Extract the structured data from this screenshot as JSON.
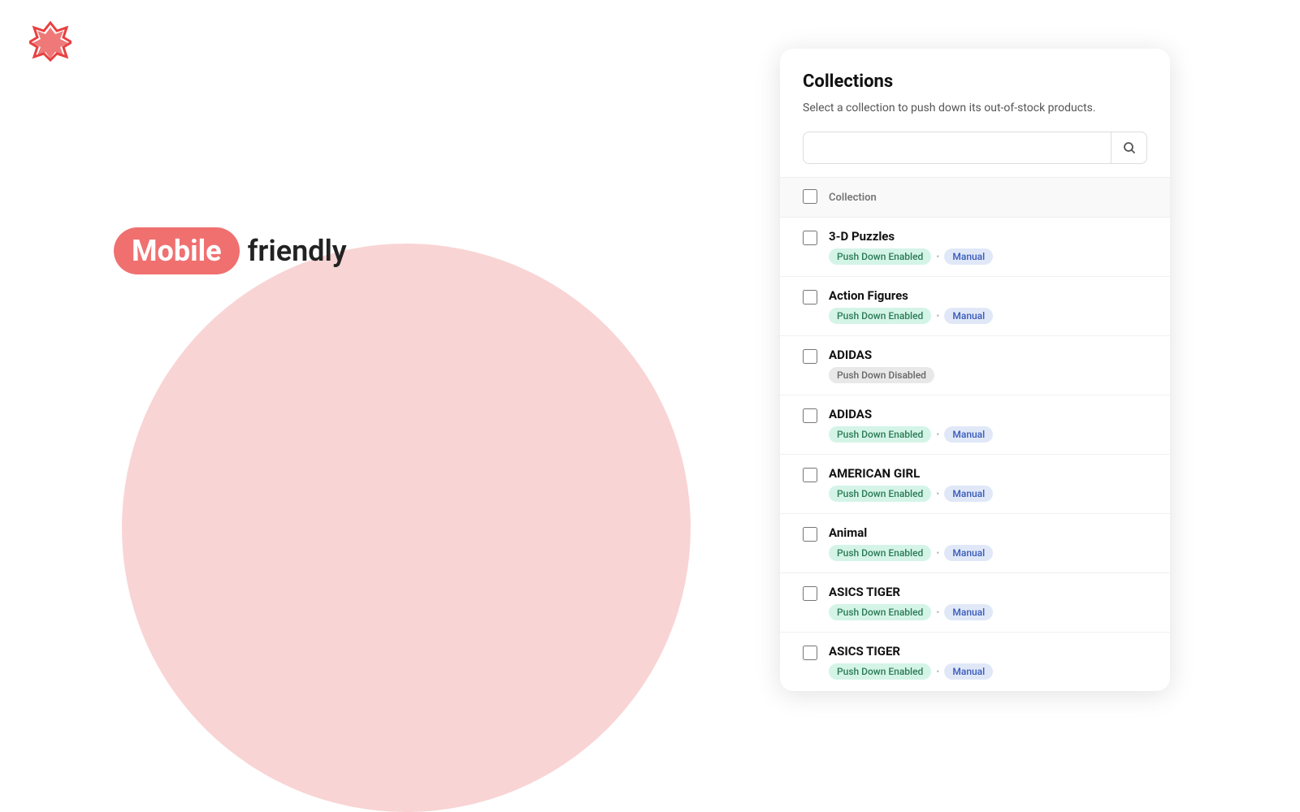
{
  "logo": {
    "alt": "App logo"
  },
  "hero": {
    "mobile_label": "Mobile",
    "friendly_label": "friendly"
  },
  "panel": {
    "title": "Collections",
    "description": "Select a collection to push down its out-of-stock products.",
    "search_placeholder": "",
    "search_button_icon": "🔍",
    "table_header": {
      "column_label": "Collection"
    },
    "items": [
      {
        "id": "3d-puzzles",
        "name": "3-D Puzzles",
        "status": "enabled",
        "status_label": "Push Down Enabled",
        "mode": "Manual",
        "checked": false
      },
      {
        "id": "action-figures",
        "name": "Action Figures",
        "status": "enabled",
        "status_label": "Push Down Enabled",
        "mode": "Manual",
        "checked": false
      },
      {
        "id": "adidas-disabled",
        "name": "ADIDAS",
        "status": "disabled",
        "status_label": "Push Down Disabled",
        "mode": null,
        "checked": false
      },
      {
        "id": "adidas-enabled",
        "name": "ADIDAS",
        "status": "enabled",
        "status_label": "Push Down Enabled",
        "mode": "Manual",
        "checked": false
      },
      {
        "id": "american-girl",
        "name": "AMERICAN GIRL",
        "status": "enabled",
        "status_label": "Push Down Enabled",
        "mode": "Manual",
        "checked": false
      },
      {
        "id": "animal",
        "name": "Animal",
        "status": "enabled",
        "status_label": "Push Down Enabled",
        "mode": "Manual",
        "checked": false
      },
      {
        "id": "asics-tiger-1",
        "name": "ASICS TIGER",
        "status": "enabled",
        "status_label": "Push Down Enabled",
        "mode": "Manual",
        "checked": false
      },
      {
        "id": "asics-tiger-2",
        "name": "ASICS TIGER",
        "status": "enabled",
        "status_label": "Push Down Enabled",
        "mode": "Manual",
        "checked": false
      }
    ]
  }
}
